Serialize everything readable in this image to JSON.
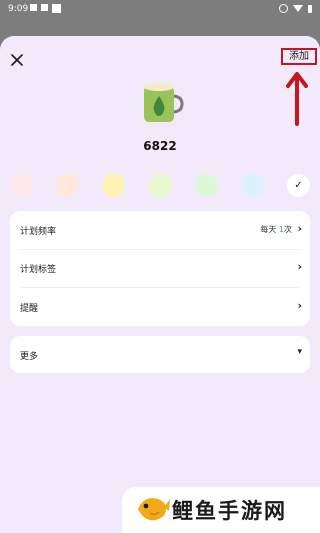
{
  "status_bar": {
    "time": "9:09"
  },
  "header": {
    "close_icon": "close-icon",
    "add_label": "添加"
  },
  "plan": {
    "icon": "mug-icon",
    "name": "6822"
  },
  "color_swatches": {
    "colors": [
      "#ffe8ea",
      "#ffe7dc",
      "#fff3b3",
      "#e9f8cf",
      "#ddf7d9",
      "#dcf1fd"
    ],
    "selected_check_icon": "check-icon"
  },
  "settings": {
    "frequency": {
      "label": "计划频率",
      "value_prefix": "每天 ",
      "value_count": "1",
      "value_suffix": "次"
    },
    "tags": {
      "label": "计划标签"
    },
    "reminder": {
      "label": "提醒"
    },
    "more": {
      "label": "更多"
    }
  },
  "accent_colors": {
    "highlight": "#c4161c",
    "count_green": "#34b25a"
  },
  "watermark": {
    "text": "鲤鱼手游网"
  }
}
